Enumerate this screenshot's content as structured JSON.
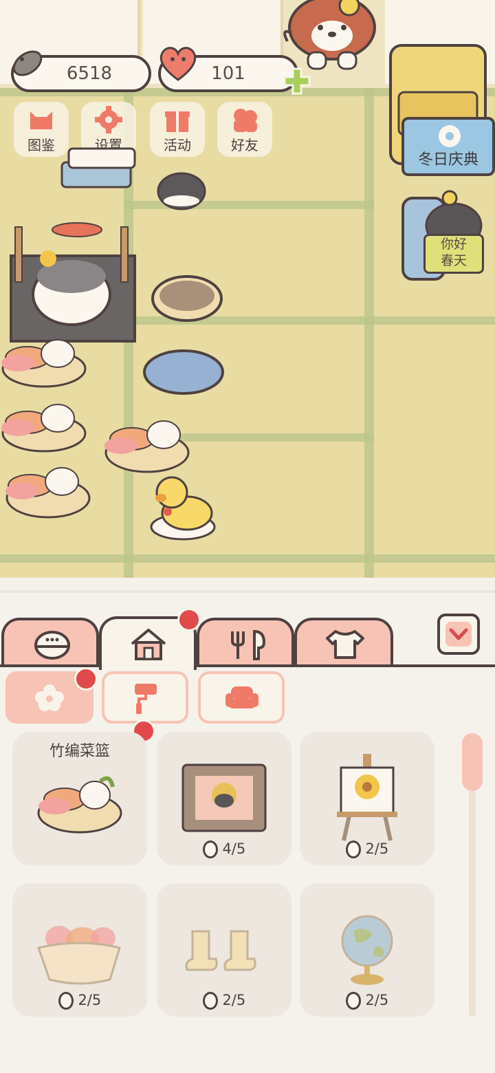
{
  "hud": {
    "fish_currency": "6518",
    "heart_currency": "101",
    "add_icon": "plus-icon"
  },
  "menu": [
    {
      "label": "图鉴",
      "icon": "cat-face-icon"
    },
    {
      "label": "设置",
      "icon": "gear-icon"
    },
    {
      "label": "活动",
      "icon": "gift-icon"
    },
    {
      "label": "好友",
      "icon": "friends-icon"
    }
  ],
  "events": {
    "winter": "冬日庆典",
    "spring_line1": "你好",
    "spring_line2": "春天"
  },
  "tabs": [
    {
      "icon": "rice-ball-icon",
      "active": false
    },
    {
      "icon": "house-icon",
      "active": true
    },
    {
      "icon": "fork-spoon-icon",
      "active": false
    },
    {
      "icon": "shirt-icon",
      "active": false
    }
  ],
  "subtabs": [
    {
      "icon": "flower-icon",
      "active": true
    },
    {
      "icon": "paint-roller-icon",
      "active": false
    },
    {
      "icon": "sofa-icon",
      "active": false
    }
  ],
  "items": [
    {
      "name": "竹编菜篮",
      "count": "",
      "icon": "vegetable-basket-icon"
    },
    {
      "name": "",
      "count": "4/5",
      "icon": "framed-picture-icon"
    },
    {
      "name": "",
      "count": "2/5",
      "icon": "sunflower-easel-icon"
    },
    {
      "name": "",
      "count": "2/5",
      "icon": "pumpkin-basket-icon"
    },
    {
      "name": "",
      "count": "2/5",
      "icon": "boots-icon"
    },
    {
      "name": "",
      "count": "2/5",
      "icon": "globe-icon"
    }
  ],
  "colors": {
    "accent": "#f7c3b5",
    "badge": "#e04a4c",
    "outline": "#4e4140",
    "floor": "#e8dca3"
  }
}
